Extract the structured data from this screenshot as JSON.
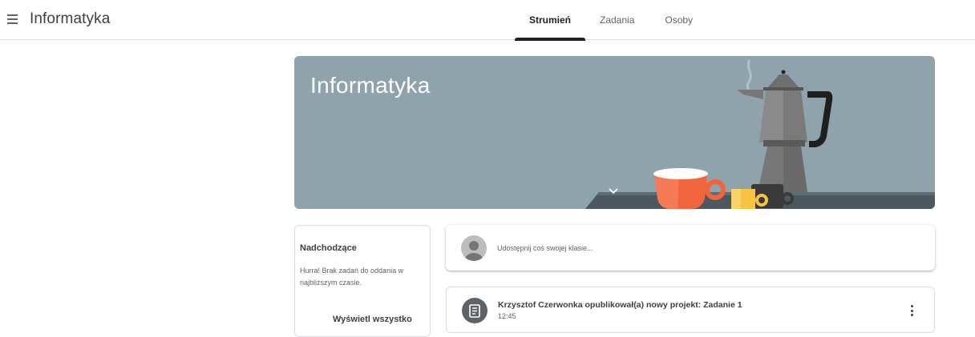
{
  "app": {
    "title": "Informatyka"
  },
  "tabs": [
    {
      "label": "Strumień",
      "active": true
    },
    {
      "label": "Zadania",
      "active": false
    },
    {
      "label": "Osoby",
      "active": false
    }
  ],
  "banner": {
    "title": "Informatyka",
    "color": "#8fa3ad"
  },
  "upcoming": {
    "title": "Nadchodzące",
    "text": "Hurra! Brak zadań do oddania w najbliższym czasie.",
    "view_all": "Wyświetl wszystko"
  },
  "share": {
    "placeholder": "Udostępnij coś swojej klasie..."
  },
  "post": {
    "title": "Krzysztof Czerwonka opublikował(a) nowy projekt: Zadanie 1",
    "time": "12:45"
  },
  "icons": [
    "menu-icon",
    "chevron-down-icon",
    "avatar-icon",
    "assignment-icon",
    "more-vert-icon"
  ]
}
